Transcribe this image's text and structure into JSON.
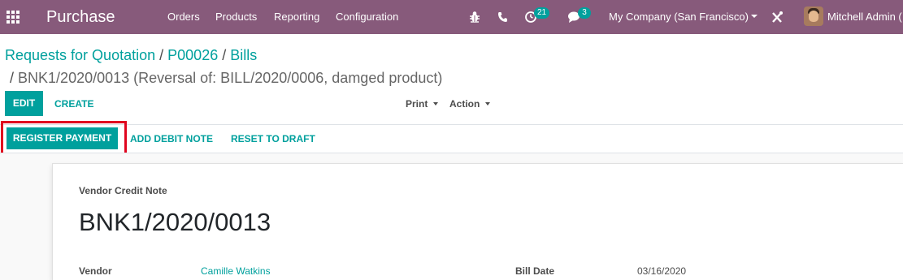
{
  "navbar": {
    "app_name": "Purchase",
    "menu": [
      "Orders",
      "Products",
      "Reporting",
      "Configuration"
    ],
    "activity_count": "21",
    "message_count": "3",
    "company": "My Company (San Francisco)",
    "user": "Mitchell Admin (",
    "icons": [
      "apps-grid-icon",
      "bug-icon",
      "phone-icon",
      "clock-icon",
      "chat-icon",
      "tools-icon"
    ],
    "colors": {
      "bar": "#875a7b",
      "badge": "#00a09d"
    }
  },
  "breadcrumb": {
    "items": [
      "Requests for Quotation",
      "P00026",
      "Bills"
    ],
    "separator": "/",
    "active": "BNK1/2020/0013 (Reversal of: BILL/2020/0006, damged product)"
  },
  "control": {
    "edit": "EDIT",
    "create": "CREATE",
    "print": "Print",
    "action": "Action"
  },
  "statusbar": {
    "register_payment": "REGISTER PAYMENT",
    "add_debit_note": "ADD DEBIT NOTE",
    "reset_to_draft": "RESET TO DRAFT",
    "highlight_color": "#e0051f"
  },
  "form": {
    "doc_type": "Vendor Credit Note",
    "name": "BNK1/2020/0013",
    "vendor_label": "Vendor",
    "vendor_value": "Camille Watkins",
    "bill_date_label": "Bill Date",
    "bill_date_value": "03/16/2020"
  },
  "accent_color": "#00a09d"
}
